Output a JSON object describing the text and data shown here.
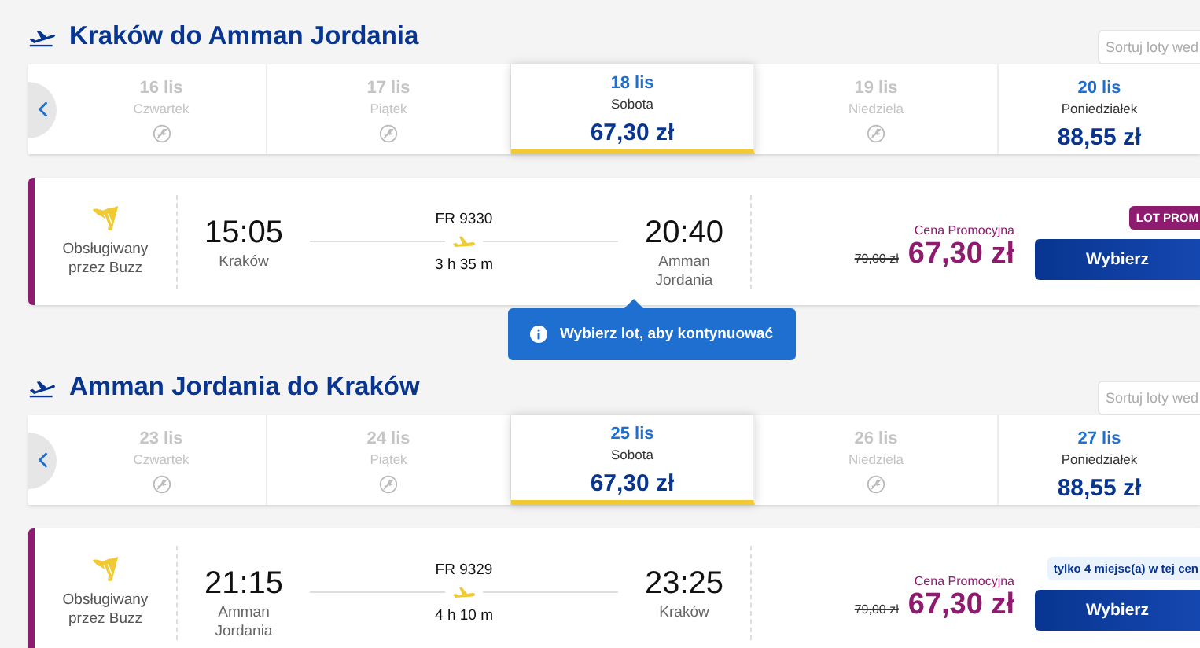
{
  "sections": [
    {
      "title": "Kraków do Amman Jordania",
      "sort_placeholder": "Sortuj loty wed",
      "dates": [
        {
          "date": "16 lis",
          "weekday": "Czwartek",
          "available": false,
          "selected": false
        },
        {
          "date": "17 lis",
          "weekday": "Piątek",
          "available": false,
          "selected": false
        },
        {
          "date": "18 lis",
          "weekday": "Sobota",
          "available": true,
          "price": "67,30 zł",
          "selected": true
        },
        {
          "date": "19 lis",
          "weekday": "Niedziela",
          "available": false,
          "selected": false
        },
        {
          "date": "20 lis",
          "weekday": "Poniedziałek",
          "available": true,
          "price": "88,55 zł",
          "selected": false
        }
      ],
      "flight": {
        "operator": "Obsługiwany przez Buzz",
        "depart_time": "15:05",
        "depart_city": "Kraków",
        "flight_no": "FR 9330",
        "duration": "3 h 35 m",
        "arrive_time": "20:40",
        "arrive_city": "Amman Jordania",
        "price_label": "Cena Promocyjna",
        "old_price": "79,00 zł",
        "price": "67,30 zł",
        "badge": {
          "kind": "promo",
          "text": "LOT PROM"
        },
        "button": "Wybierz"
      },
      "notice": "Wybierz lot, aby kontynuować"
    },
    {
      "title": "Amman Jordania do Kraków",
      "sort_placeholder": "Sortuj loty wed",
      "dates": [
        {
          "date": "23 lis",
          "weekday": "Czwartek",
          "available": false,
          "selected": false
        },
        {
          "date": "24 lis",
          "weekday": "Piątek",
          "available": false,
          "selected": false
        },
        {
          "date": "25 lis",
          "weekday": "Sobota",
          "available": true,
          "price": "67,30 zł",
          "selected": true
        },
        {
          "date": "26 lis",
          "weekday": "Niedziela",
          "available": false,
          "selected": false
        },
        {
          "date": "27 lis",
          "weekday": "Poniedziałek",
          "available": true,
          "price": "88,55 zł",
          "selected": false
        }
      ],
      "flight": {
        "operator": "Obsługiwany przez Buzz",
        "depart_time": "21:15",
        "depart_city": "Amman Jordania",
        "flight_no": "FR 9329",
        "duration": "4 h 10 m",
        "arrive_time": "23:25",
        "arrive_city": "Kraków",
        "price_label": "Cena Promocyjna",
        "old_price": "79,00 zł",
        "price": "67,30 zł",
        "badge": {
          "kind": "seats",
          "text": "tylko 4 miejsc(a) w tej cen"
        },
        "button": "Wybierz"
      }
    }
  ]
}
